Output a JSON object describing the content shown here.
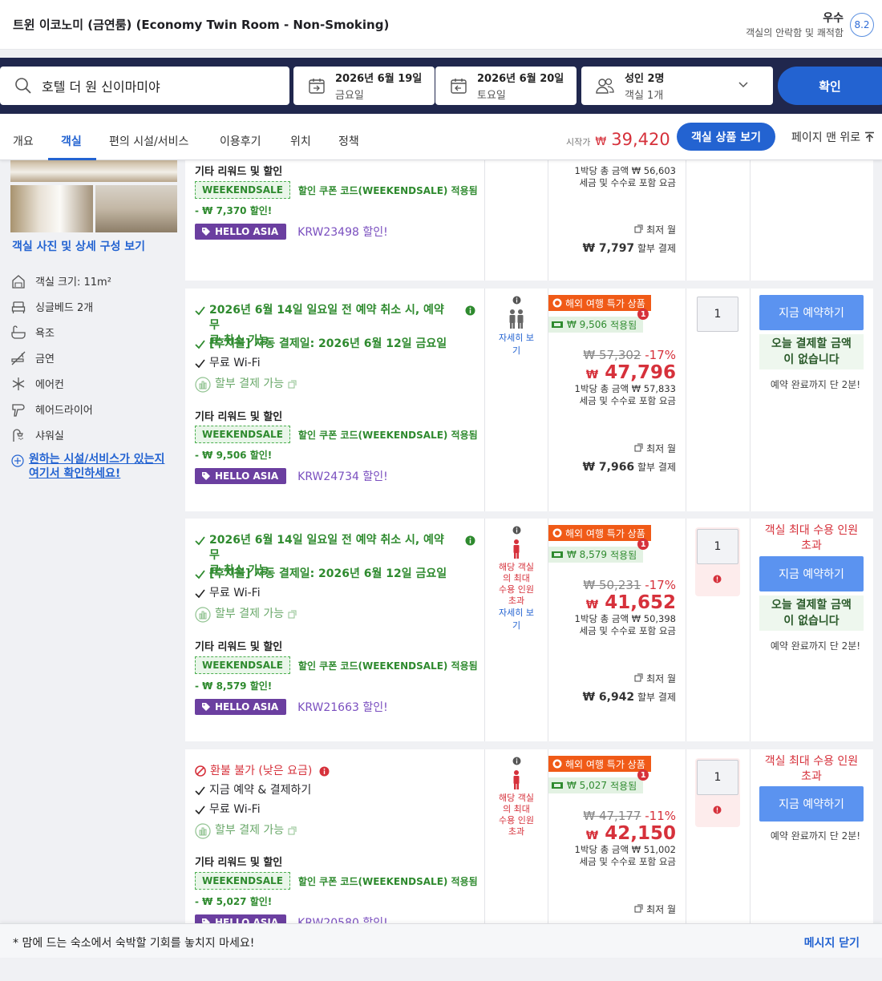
{
  "room_title": "트윈 이코노미 (금연룸) (Economy Twin Room - Non-Smoking)",
  "rating": {
    "label": "우수",
    "sub": "객실의 안락함 및 쾌적함",
    "score": "8.2"
  },
  "search": {
    "destination": "호텔 더 원 신이마미야",
    "checkin": {
      "date": "2026년 6월 19일",
      "day": "금요일"
    },
    "checkout": {
      "date": "2026년 6월 20일",
      "day": "토요일"
    },
    "guests": "성인 2명",
    "rooms": "객실 1개",
    "confirm": "확인"
  },
  "tabs": [
    "개요",
    "객실",
    "편의 시설/서비스",
    "이용후기",
    "위치",
    "정책"
  ],
  "start_price": {
    "label": "시작가",
    "currency": "₩",
    "value": "39,420"
  },
  "view_offers": "객실 상품 보기",
  "to_top": "페이지 맨 위로",
  "left": {
    "room_link": "객실 사진 및 상세 구성 보기",
    "amenities": [
      "객실 크기: 11m²",
      "싱글베드 2개",
      "욕조",
      "금연",
      "에어컨",
      "헤어드라이어",
      "샤워실"
    ],
    "facility_link": [
      "원하는 시설/서비스가 있는지",
      "여기서 확인하세요!"
    ]
  },
  "common": {
    "free_wifi": "무료 Wi-Fi",
    "installment": "할부 결제 가능",
    "rewards": "기타 리워드 및 할인",
    "coupon_code": "WEEKENDSALE",
    "coupon_text": "할인 쿠폰 코드(WEEKENDSALE) 적용됨",
    "hello_asia": "HELLO ASIA",
    "discount_suffix": "할인!",
    "deal": "해외 여행 특가 상품",
    "applied_suffix": "적용됨",
    "per_night": "1박당 총 금액",
    "tax_note": "세금 및 수수료 포함 요금",
    "min_month": "최저 월",
    "installment_pay": "할부 결제",
    "book_now": "지금 예약하기",
    "no_pay_today": [
      "오늘 결제할 금액",
      "이 없습니다"
    ],
    "two_min": "예약 완료까지 단 2분!",
    "details": [
      "자세히 보",
      "기"
    ],
    "over_capacity": [
      "해당 객실",
      "의 최대",
      "수용 인원",
      "초과"
    ],
    "max_capacity": [
      "객실 최대 수용 인원",
      "초과"
    ],
    "won": "₩"
  },
  "cards": [
    {
      "reward_discount": "- ₩ 7,370 할인!",
      "code": "KRW23498",
      "per_night": "₩ 56,603",
      "installment": "₩ 7,797"
    },
    {
      "cancel": [
        "2026년 6월 14일 일요일 전 예약 취소 시, 예약 무",
        "료 취소 가능"
      ],
      "pay_later": "[후지불] 자동 결제일: 2026년 6월 12일 금요일",
      "reward_discount": "- ₩ 9,506 할인!",
      "code": "KRW24734",
      "applied": "₩ 9,506",
      "orig": "₩ 57,302",
      "pct": "-17%",
      "final": "47,796",
      "per_night": "₩ 57,833",
      "installment": "₩ 7,966",
      "qty": "1"
    },
    {
      "cancel": [
        "2026년 6월 14일 일요일 전 예약 취소 시, 예약 무",
        "료 취소 가능"
      ],
      "pay_later": "[후지불] 자동 결제일: 2026년 6월 12일 금요일",
      "reward_discount": "- ₩ 8,579 할인!",
      "code": "KRW21663",
      "applied": "₩ 8,579",
      "orig": "₩ 50,231",
      "pct": "-17%",
      "final": "41,652",
      "per_night": "₩ 50,398",
      "installment": "₩ 6,942",
      "qty": "1"
    },
    {
      "nonrefund": "환불 불가 (낮은 요금)",
      "pay_now": "지금 예약 & 결제하기",
      "reward_discount": "- ₩ 5,027 할인!",
      "code": "KRW20580",
      "applied": "₩ 5,027",
      "orig": "₩ 47,177",
      "pct": "-11%",
      "final": "42,150",
      "per_night": "₩ 51,002",
      "qty": "1"
    }
  ],
  "banner": {
    "message": "* 맘에 드는 숙소에서 숙박할 기회를 놓치지 마세요!",
    "close": "메시지 닫기"
  }
}
